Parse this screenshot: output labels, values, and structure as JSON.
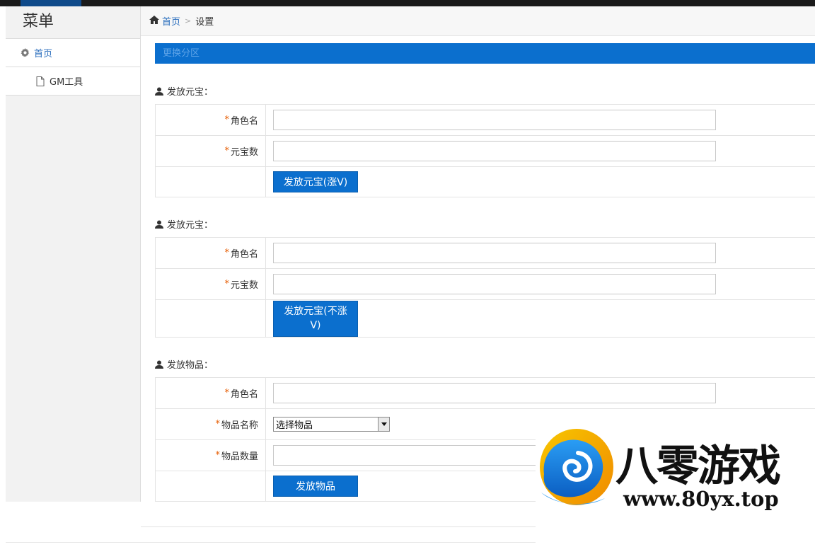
{
  "sidebar": {
    "title": "菜单",
    "items": [
      {
        "label": "首页",
        "icon": "gear-icon"
      },
      {
        "label": "GM工具",
        "icon": "file-icon"
      }
    ]
  },
  "breadcrumb": {
    "home": "首页",
    "current": "设置"
  },
  "switch_bar": {
    "label": "更换分区"
  },
  "sections": [
    {
      "title": "发放元宝：",
      "fields": [
        {
          "label": "角色名",
          "value": ""
        },
        {
          "label": "元宝数",
          "value": ""
        }
      ],
      "button": "发放元宝(涨V)"
    },
    {
      "title": "发放元宝：",
      "fields": [
        {
          "label": "角色名",
          "value": ""
        },
        {
          "label": "元宝数",
          "value": ""
        }
      ],
      "button": "发放元宝(不涨V)"
    },
    {
      "title": "发放物品：",
      "fields": [
        {
          "label": "角色名",
          "value": ""
        },
        {
          "label": "物品名称",
          "select_value": "选择物品"
        },
        {
          "label": "物品数量",
          "value": ""
        }
      ],
      "button": "发放物品"
    }
  ],
  "required_mark": "*",
  "watermark": {
    "name": "八零游戏",
    "url": "www.80yx.top"
  },
  "colors": {
    "primary": "#0b6fce",
    "link": "#2a6ebd",
    "required": "#e65c00",
    "topbar": "#1a1a1a"
  }
}
